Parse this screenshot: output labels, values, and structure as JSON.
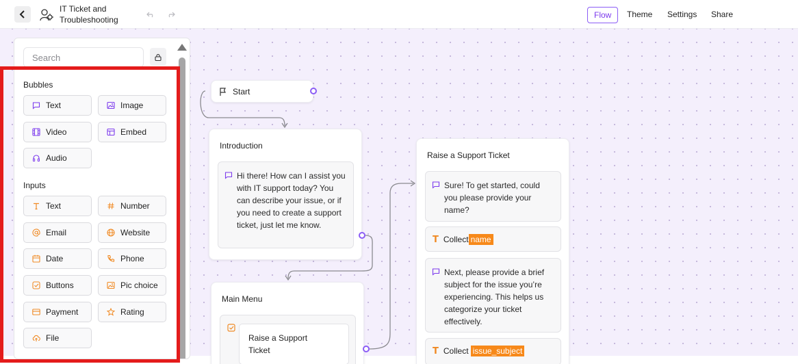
{
  "header": {
    "title_line1": "IT Ticket and",
    "title_line2": "Troubleshooting",
    "tabs": [
      "Flow",
      "Theme",
      "Settings",
      "Share"
    ],
    "active_tab": "Flow"
  },
  "sidebar": {
    "search_placeholder": "Search",
    "bubbles_title": "Bubbles",
    "bubbles": [
      {
        "label": "Text",
        "icon": "chat-bubble-icon"
      },
      {
        "label": "Image",
        "icon": "image-icon"
      },
      {
        "label": "Video",
        "icon": "film-icon"
      },
      {
        "label": "Embed",
        "icon": "embed-window-icon"
      },
      {
        "label": "Audio",
        "icon": "headphones-icon"
      }
    ],
    "inputs_title": "Inputs",
    "inputs": [
      {
        "label": "Text",
        "icon": "text-t-icon"
      },
      {
        "label": "Number",
        "icon": "hash-icon"
      },
      {
        "label": "Email",
        "icon": "at-sign-icon"
      },
      {
        "label": "Website",
        "icon": "globe-icon"
      },
      {
        "label": "Date",
        "icon": "calendar-icon"
      },
      {
        "label": "Phone",
        "icon": "phone-icon"
      },
      {
        "label": "Buttons",
        "icon": "checkbox-icon"
      },
      {
        "label": "Pic choice",
        "icon": "picture-choice-icon"
      },
      {
        "label": "Payment",
        "icon": "credit-card-icon"
      },
      {
        "label": "Rating",
        "icon": "star-icon"
      },
      {
        "label": "File",
        "icon": "upload-cloud-icon"
      }
    ]
  },
  "flow": {
    "start": {
      "label": "Start"
    },
    "introduction": {
      "title": "Introduction",
      "message": "Hi there! How can I assist you with IT support today? You can describe your issue, or if you need to create a support ticket, just let me know."
    },
    "main_menu": {
      "title": "Main Menu",
      "button_label": "Raise a Support Ticket"
    },
    "raise_ticket": {
      "title": "Raise a Support Ticket",
      "message1": "Sure! To get started, could you please provide your name?",
      "collect1_label": "Collect",
      "collect1_var": "name",
      "message2": "Next, please provide a brief subject for the issue you’re experiencing. This helps us categorize your ticket effectively.",
      "collect2_label": "Collect",
      "collect2_var": "issue_subject"
    }
  },
  "colors": {
    "accent": "#8b5cf6",
    "canvas": "#f4effc",
    "highlight": "#e41b1b",
    "variable_tag": "#f7891a",
    "input_icon": "#f08a24",
    "bubble_icon": "#7c3aed"
  }
}
